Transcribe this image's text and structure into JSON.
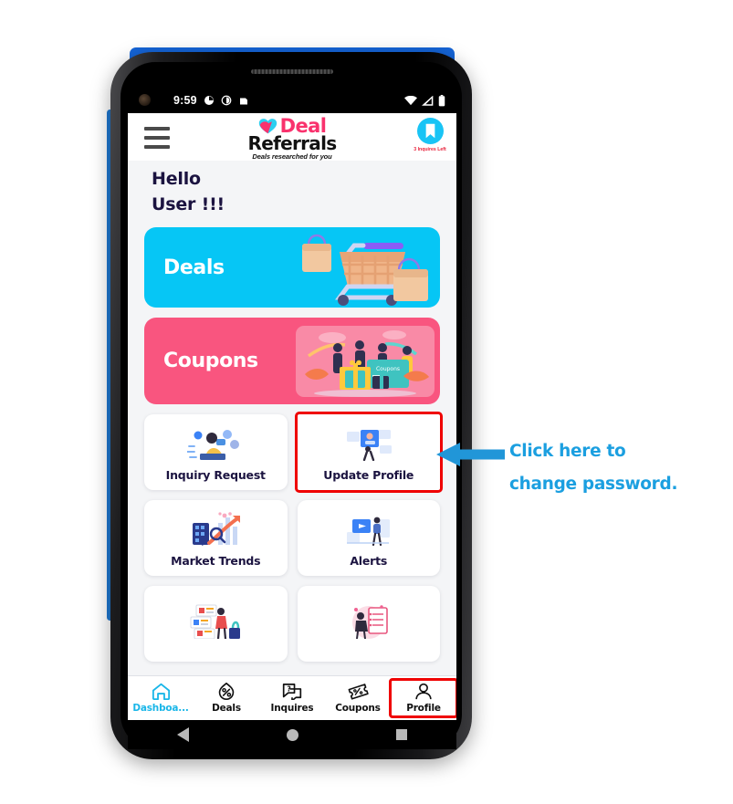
{
  "status_bar": {
    "time": "9:59",
    "left_icons": [
      "camera-punchhole",
      "notification-icon",
      "notification-icon",
      "notification-icon"
    ],
    "right_icons": [
      "wifi-icon",
      "cellular-signal-icon",
      "battery-icon"
    ]
  },
  "app_header": {
    "menu_icon": "hamburger-menu-icon",
    "brand": {
      "word_mark_1": "Deal",
      "word_mark_2": "Referrals",
      "tagline": "Deals researched for you",
      "heart_icon": "heart-icon"
    },
    "badge": {
      "icon": "bookmark-icon",
      "label": "3 Inquires Left"
    }
  },
  "greeting": {
    "line1": "Hello",
    "line2": "User !!!"
  },
  "banners": [
    {
      "label": "Deals",
      "art": "shopping-cart-illustration",
      "color": "#06c6f5"
    },
    {
      "label": "Coupons",
      "art": "coupons-people-illustration",
      "color": "#f9557f"
    }
  ],
  "tiles": [
    {
      "label": "Inquiry Request",
      "art": "support-agent-illustration",
      "highlighted": false
    },
    {
      "label": "Update Profile",
      "art": "profile-card-illustration",
      "highlighted": true
    },
    {
      "label": "Market Trends",
      "art": "market-chart-illustration",
      "highlighted": false
    },
    {
      "label": "Alerts",
      "art": "alert-megaphone-illustration",
      "highlighted": false
    },
    {
      "label": "",
      "art": "listings-illustration",
      "highlighted": false
    },
    {
      "label": "",
      "art": "checklist-illustration",
      "highlighted": false
    }
  ],
  "bottom_nav": [
    {
      "label": "Dashboa...",
      "icon": "home-icon",
      "active": true,
      "highlighted": false
    },
    {
      "label": "Deals",
      "icon": "discount-icon",
      "active": false,
      "highlighted": false
    },
    {
      "label": "Inquires",
      "icon": "chat-question-icon",
      "active": false,
      "highlighted": false
    },
    {
      "label": "Coupons",
      "icon": "ticket-icon",
      "active": false,
      "highlighted": false
    },
    {
      "label": "Profile",
      "icon": "person-icon",
      "active": false,
      "highlighted": true
    }
  ],
  "android_nav": {
    "back": "back-triangle-icon",
    "home": "home-circle-icon",
    "recents": "recents-square-icon"
  },
  "annotation": {
    "line1": "Click here to",
    "line2": "change password.",
    "arrow": "left-arrow-icon",
    "color": "#1b9fe0"
  },
  "colors": {
    "accent_cyan": "#06c6f5",
    "accent_pink": "#f9557f",
    "highlight_red": "#ef0000",
    "navy_text": "#1b1340",
    "annotation_blue": "#1b9fe0"
  }
}
